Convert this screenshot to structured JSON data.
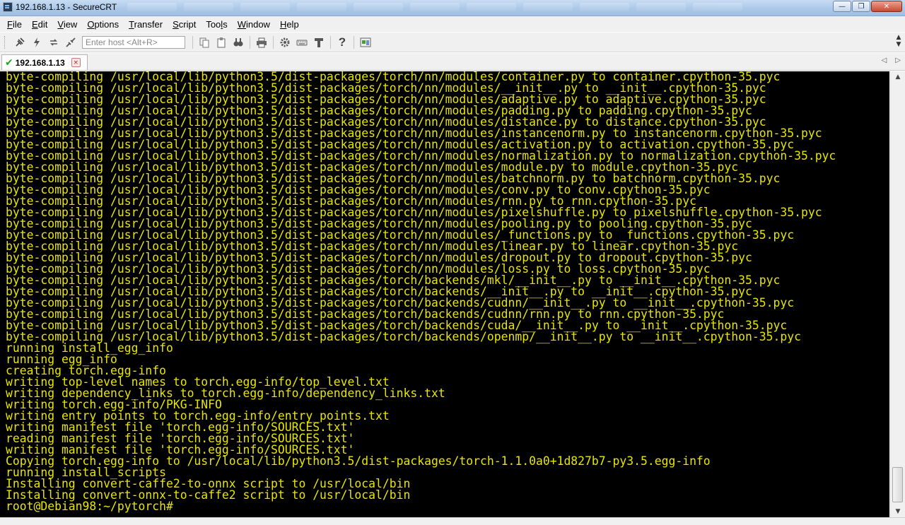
{
  "window": {
    "title": "192.168.1.13 - SecureCRT",
    "minimize_glyph": "—",
    "maximize_glyph": "❐",
    "close_glyph": "✕"
  },
  "menu": {
    "items": [
      {
        "label": "File",
        "accel_index": 0
      },
      {
        "label": "Edit",
        "accel_index": 0
      },
      {
        "label": "View",
        "accel_index": 0
      },
      {
        "label": "Options",
        "accel_index": 0
      },
      {
        "label": "Transfer",
        "accel_index": 0
      },
      {
        "label": "Script",
        "accel_index": 0
      },
      {
        "label": "Tools",
        "accel_index": 3
      },
      {
        "label": "Window",
        "accel_index": 0
      },
      {
        "label": "Help",
        "accel_index": 0
      }
    ]
  },
  "toolbar": {
    "host_placeholder": "Enter host <Alt+R>",
    "icons": [
      "connect-icon",
      "quick-connect-icon",
      "reconnect-icon",
      "disconnect-icon"
    ],
    "icons_after_input": [
      "copy-icon",
      "paste-icon",
      "find-icon",
      "print-icon",
      "settings-icon",
      "keymap-icon",
      "sftp-icon",
      "help-icon",
      "sessions-icon"
    ]
  },
  "tab": {
    "label": "192.168.1.13",
    "check_glyph": "✔",
    "close_glyph": "×",
    "nav_prev": "◁",
    "nav_next": "▷"
  },
  "terminal": {
    "colors": {
      "foreground": "#e6e600",
      "background": "#000000"
    },
    "lines": [
      "byte-compiling /usr/local/lib/python3.5/dist-packages/torch/nn/modules/container.py to container.cpython-35.pyc",
      "byte-compiling /usr/local/lib/python3.5/dist-packages/torch/nn/modules/__init__.py to __init__.cpython-35.pyc",
      "byte-compiling /usr/local/lib/python3.5/dist-packages/torch/nn/modules/adaptive.py to adaptive.cpython-35.pyc",
      "byte-compiling /usr/local/lib/python3.5/dist-packages/torch/nn/modules/padding.py to padding.cpython-35.pyc",
      "byte-compiling /usr/local/lib/python3.5/dist-packages/torch/nn/modules/distance.py to distance.cpython-35.pyc",
      "byte-compiling /usr/local/lib/python3.5/dist-packages/torch/nn/modules/instancenorm.py to instancenorm.cpython-35.pyc",
      "byte-compiling /usr/local/lib/python3.5/dist-packages/torch/nn/modules/activation.py to activation.cpython-35.pyc",
      "byte-compiling /usr/local/lib/python3.5/dist-packages/torch/nn/modules/normalization.py to normalization.cpython-35.pyc",
      "byte-compiling /usr/local/lib/python3.5/dist-packages/torch/nn/modules/module.py to module.cpython-35.pyc",
      "byte-compiling /usr/local/lib/python3.5/dist-packages/torch/nn/modules/batchnorm.py to batchnorm.cpython-35.pyc",
      "byte-compiling /usr/local/lib/python3.5/dist-packages/torch/nn/modules/conv.py to conv.cpython-35.pyc",
      "byte-compiling /usr/local/lib/python3.5/dist-packages/torch/nn/modules/rnn.py to rnn.cpython-35.pyc",
      "byte-compiling /usr/local/lib/python3.5/dist-packages/torch/nn/modules/pixelshuffle.py to pixelshuffle.cpython-35.pyc",
      "byte-compiling /usr/local/lib/python3.5/dist-packages/torch/nn/modules/pooling.py to pooling.cpython-35.pyc",
      "byte-compiling /usr/local/lib/python3.5/dist-packages/torch/nn/modules/_functions.py to _functions.cpython-35.pyc",
      "byte-compiling /usr/local/lib/python3.5/dist-packages/torch/nn/modules/linear.py to linear.cpython-35.pyc",
      "byte-compiling /usr/local/lib/python3.5/dist-packages/torch/nn/modules/dropout.py to dropout.cpython-35.pyc",
      "byte-compiling /usr/local/lib/python3.5/dist-packages/torch/nn/modules/loss.py to loss.cpython-35.pyc",
      "byte-compiling /usr/local/lib/python3.5/dist-packages/torch/backends/mkl/__init__.py to __init__.cpython-35.pyc",
      "byte-compiling /usr/local/lib/python3.5/dist-packages/torch/backends/__init__.py to __init__.cpython-35.pyc",
      "byte-compiling /usr/local/lib/python3.5/dist-packages/torch/backends/cudnn/__init__.py to __init__.cpython-35.pyc",
      "byte-compiling /usr/local/lib/python3.5/dist-packages/torch/backends/cudnn/rnn.py to rnn.cpython-35.pyc",
      "byte-compiling /usr/local/lib/python3.5/dist-packages/torch/backends/cuda/__init__.py to __init__.cpython-35.pyc",
      "byte-compiling /usr/local/lib/python3.5/dist-packages/torch/backends/openmp/__init__.py to __init__.cpython-35.pyc",
      "running install_egg_info",
      "running egg_info",
      "creating torch.egg-info",
      "writing top-level names to torch.egg-info/top_level.txt",
      "writing dependency_links to torch.egg-info/dependency_links.txt",
      "writing torch.egg-info/PKG-INFO",
      "writing entry points to torch.egg-info/entry_points.txt",
      "writing manifest file 'torch.egg-info/SOURCES.txt'",
      "reading manifest file 'torch.egg-info/SOURCES.txt'",
      "writing manifest file 'torch.egg-info/SOURCES.txt'",
      "Copying torch.egg-info to /usr/local/lib/python3.5/dist-packages/torch-1.1.0a0+1d827b7-py3.5.egg-info",
      "running install_scripts",
      "Installing convert-caffe2-to-onnx script to /usr/local/bin",
      "Installing convert-onnx-to-caffe2 script to /usr/local/bin"
    ],
    "prompt": "root@Debian98:~/pytorch#"
  },
  "scrollbar": {
    "up_glyph": "▲",
    "down_glyph": "▼"
  }
}
